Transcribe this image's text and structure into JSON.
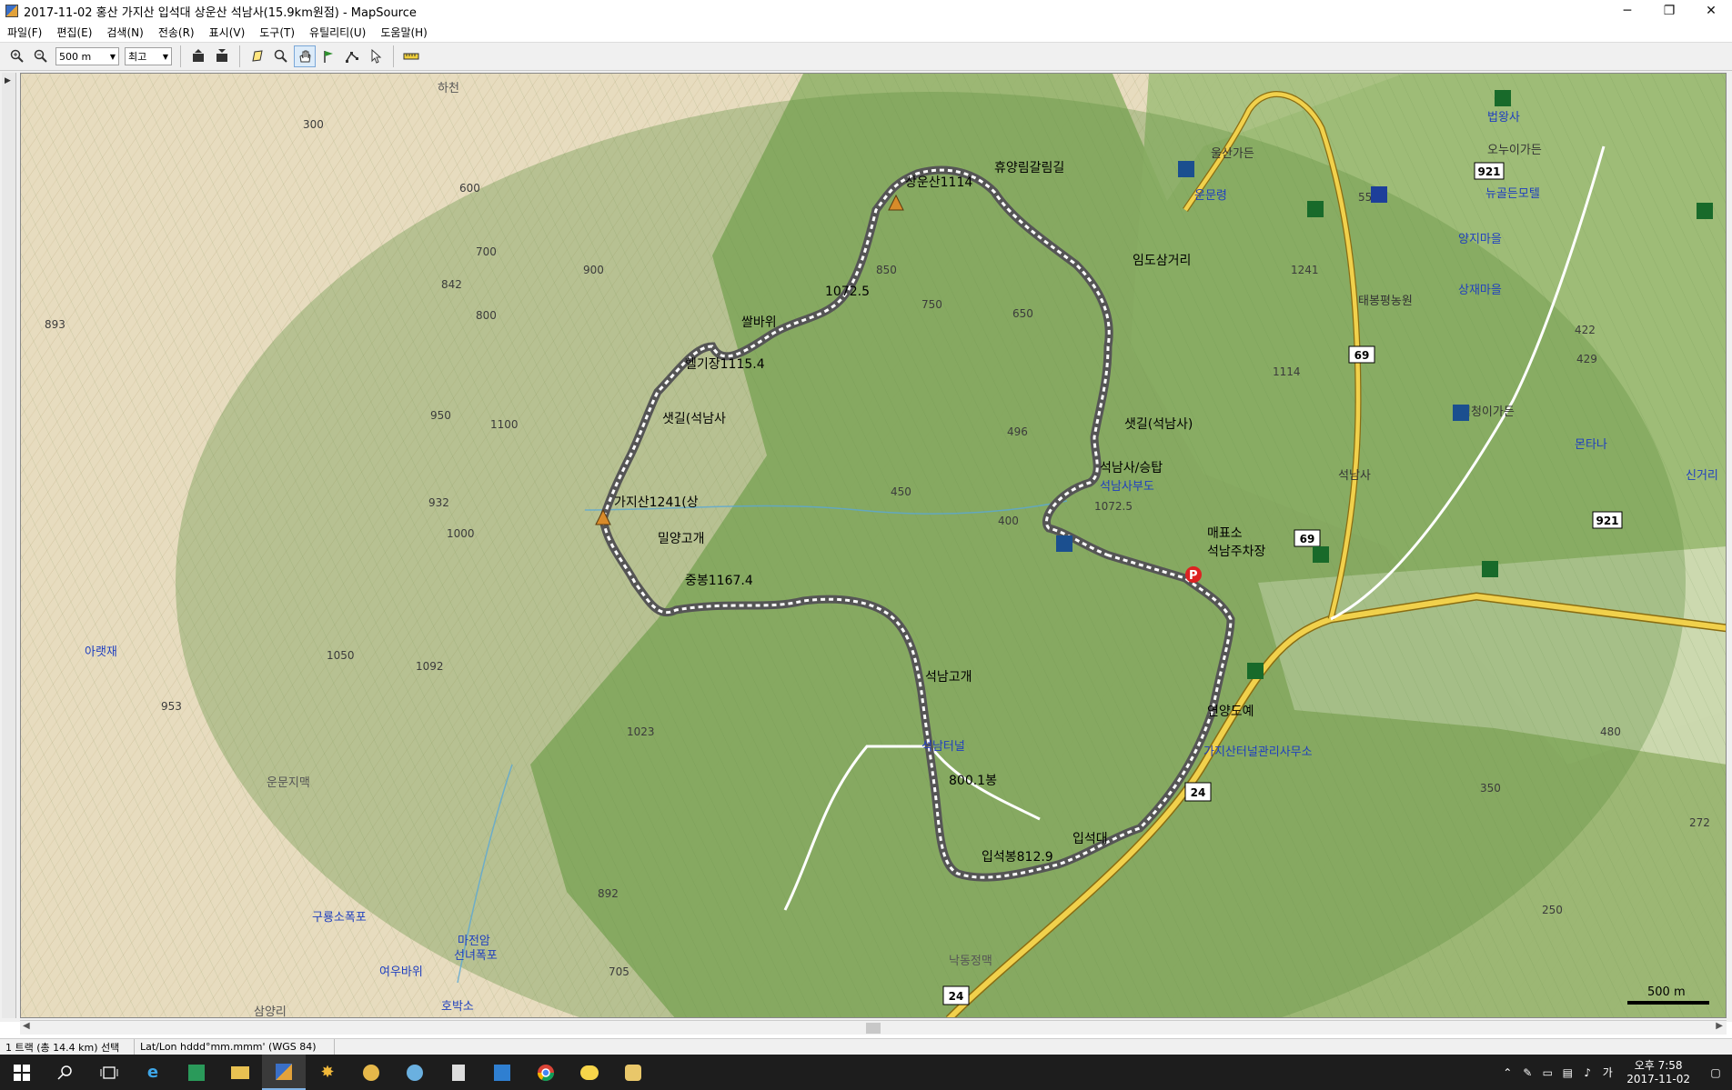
{
  "window": {
    "title": "2017-11-02 홍산 가지산 입석대 상운산 석남사(15.9km원점) - MapSource",
    "minimize": "─",
    "maximize": "❐",
    "close": "✕"
  },
  "menu": [
    "파일(F)",
    "편집(E)",
    "검색(N)",
    "전송(R)",
    "표시(V)",
    "도구(T)",
    "유틸리티(U)",
    "도움말(H)"
  ],
  "toolbar": {
    "zoom_in_icon": "🔍+",
    "zoom_out_icon": "🔍-",
    "scale_select": "500 m",
    "detail_select": "최고"
  },
  "map": {
    "colors": {
      "relief_light": "#e6dcc0",
      "forest": "#8fb26a",
      "forest_dark": "#6f9a55",
      "buffer": "#6d9b4a",
      "track": "#ffffff",
      "track_border": "#555555",
      "road": "#e8c84a",
      "label": "#000000",
      "water_label": "#1f3fbf"
    },
    "waypoints": [
      "상운산1114",
      "휴양림갈림길",
      "1072.5",
      "임도삼거리",
      "쌀바위",
      "헬기장1115.4",
      "샛길(석남사",
      "샛길(석남사)",
      "석남사/승탑",
      "가지산1241(상",
      "밀양고개",
      "매표소",
      "석남주차장",
      "중봉1167.4",
      "석남고개",
      "연양도예",
      "800.1봉",
      "입석대",
      "입석봉812.9"
    ],
    "place_labels": [
      "하천",
      "울산가든",
      "운문령",
      "법왕사",
      "태봉평농원",
      "양지마을",
      "석남사",
      "상재마을",
      "심청이가든",
      "몬타나",
      "신거리",
      "가지산터널관리사무소",
      "아랫재",
      "구룡소폭포",
      "마전암",
      "선녀폭포",
      "여우바위",
      "호박소",
      "삼양리",
      "운문지맥",
      "낙동정맥",
      "석남터널",
      "석남사부도",
      "뉴골든모텔",
      "오누이가든"
    ],
    "elevations": [
      "300",
      "550",
      "600",
      "650",
      "700",
      "750",
      "800",
      "842",
      "893",
      "850",
      "900",
      "932",
      "950",
      "1000",
      "1050",
      "1092",
      "1100",
      "1023",
      "892",
      "705",
      "496",
      "450",
      "400",
      "422",
      "429",
      "480",
      "350",
      "250",
      "272",
      "953",
      "1072.5",
      "1114",
      "1241"
    ],
    "road_shields": [
      "24",
      "69",
      "921"
    ],
    "scale_bar": "500 m"
  },
  "status": {
    "selection": "1 트랙 (총 14.4 km) 선택",
    "format": "Lat/Lon hddd°mm.mmm' (WGS 84)"
  },
  "taskbar": {
    "time": "오후 7:58",
    "date": "2017-11-02",
    "ime": "가"
  }
}
